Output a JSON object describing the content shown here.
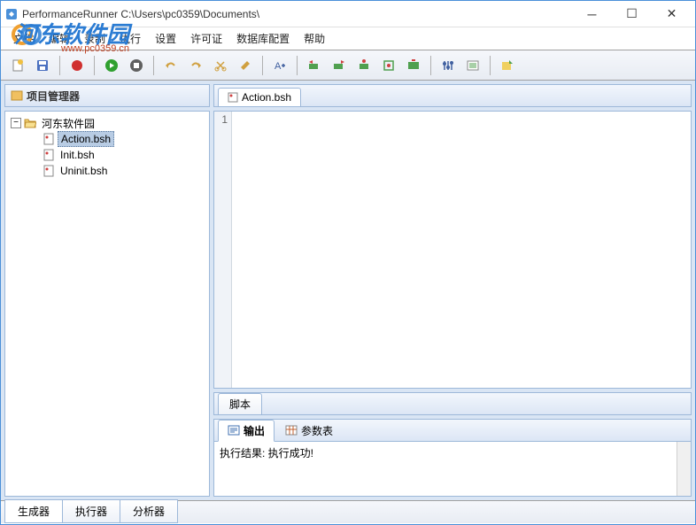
{
  "window": {
    "title": "PerformanceRunner  C:\\Users\\pc0359\\Documents\\"
  },
  "watermark": {
    "text": "河东软件园",
    "url": "www.pc0359.cn"
  },
  "menu": {
    "items": [
      "文件",
      "编辑",
      "录制",
      "执行",
      "设置",
      "许可证",
      "数据库配置",
      "帮助"
    ]
  },
  "project_panel": {
    "title": "项目管理器",
    "root": "河东软件园",
    "files": [
      "Action.bsh",
      "Init.bsh",
      "Uninit.bsh"
    ],
    "selected": "Action.bsh"
  },
  "editor": {
    "tab_label": "Action.bsh",
    "line_number": "1",
    "bottom_tab": "脚本"
  },
  "output": {
    "tab_output": "输出",
    "tab_params": "参数表",
    "result_text": "执行结果: 执行成功!"
  },
  "footer": {
    "tabs": [
      "生成器",
      "执行器",
      "分析器"
    ]
  }
}
